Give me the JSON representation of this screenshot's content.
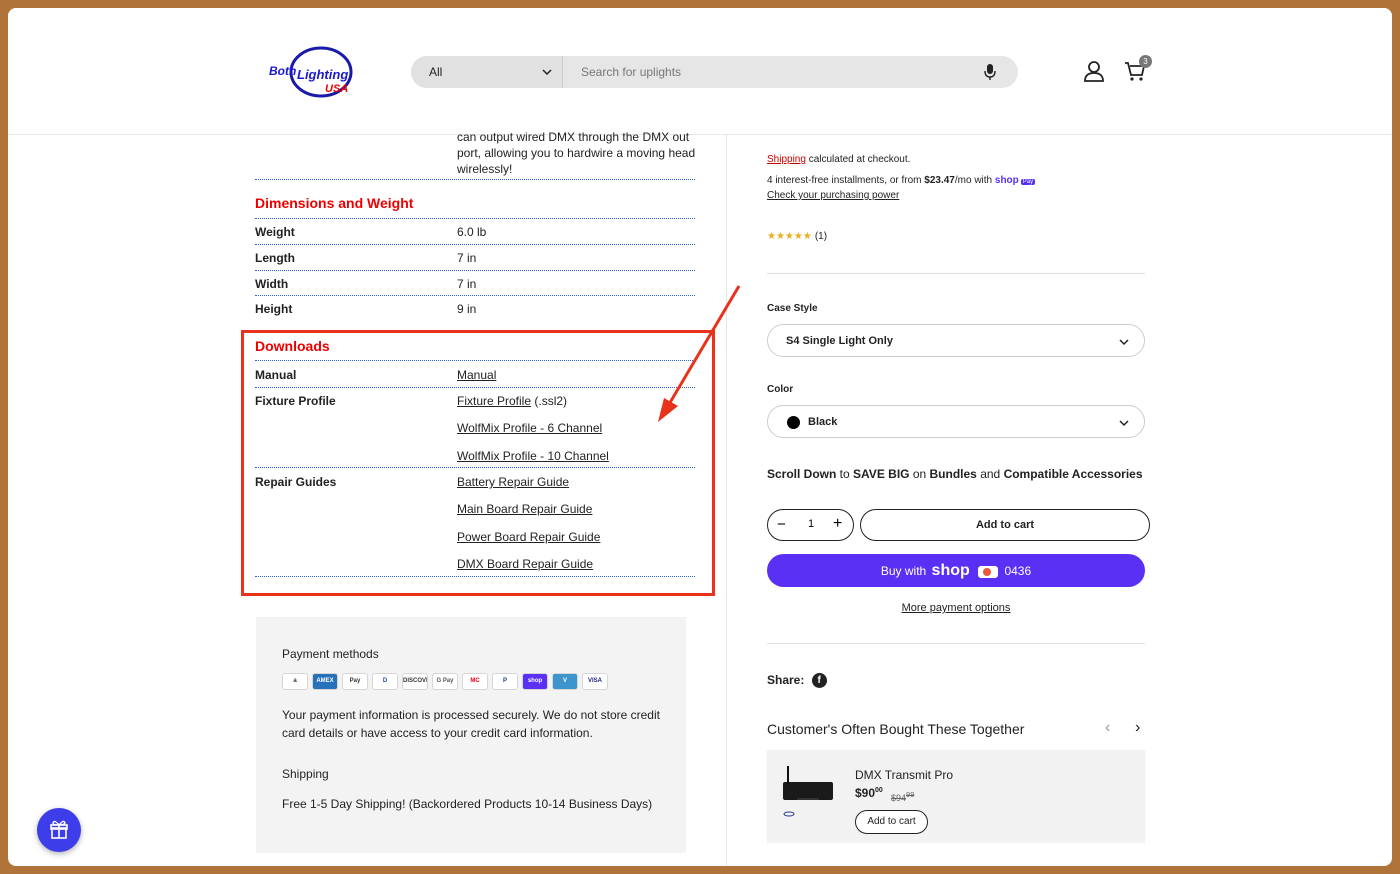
{
  "header": {
    "logo_text": "BothLighting USA",
    "category": "All",
    "search_placeholder": "Search for uplights",
    "cart_count": "3"
  },
  "left": {
    "cut_text": "can output wired DMX through the DMX out port, allowing you to hardwire a moving head wirelessly!",
    "dimensions_title": "Dimensions and Weight",
    "dimensions": [
      {
        "label": "Weight",
        "value": "6.0 lb"
      },
      {
        "label": "Length",
        "value": "7 in"
      },
      {
        "label": "Width",
        "value": "7 in"
      },
      {
        "label": "Height",
        "value": "9 in"
      }
    ],
    "downloads_title": "Downloads",
    "manual_label": "Manual",
    "manual_link": "Manual",
    "fixture_label": "Fixture Profile",
    "fixture_link": "Fixture Profile",
    "fixture_suffix": " (.ssl2)",
    "wolfmix6": "WolfMix Profile - 6 Channel",
    "wolfmix10": "WolfMix Profile - 10 Channel",
    "repair_label": "Repair Guides",
    "repair_links": [
      "Battery Repair Guide",
      "Main Board Repair Guide",
      "Power Board Repair Guide",
      "DMX Board Repair Guide"
    ],
    "payment_title": "Payment methods",
    "payment_icons": [
      "a",
      "AMEX",
      "Pay",
      "D",
      "DISCOVER",
      "G Pay",
      "MC",
      "P",
      "shop",
      "V",
      "VISA"
    ],
    "payment_text": "Your payment information is processed securely. We do not store credit card details or have access to your credit card information.",
    "shipping_title": "Shipping",
    "shipping_text": "Free 1-5 Day Shipping! (Backordered Products 10-14 Business Days)"
  },
  "right": {
    "shipping_link": "Shipping",
    "shipping_rest": " calculated at checkout.",
    "installments_pre": "4 interest-free installments, or from ",
    "installments_amount": "$23.47",
    "installments_post": "/mo with ",
    "shop_pay": "shop",
    "check_power": "Check your purchasing power",
    "review_count": "(1)",
    "case_label": "Case Style",
    "case_value": "S4 Single Light Only",
    "color_label": "Color",
    "color_value": "Black",
    "promo_a": "Scroll Down",
    "promo_b": " to ",
    "promo_c": "SAVE BIG",
    "promo_d": " on ",
    "promo_e": "Bundles",
    "promo_f": " and ",
    "promo_g": "Compatible Accessories",
    "qty": "1",
    "add_to_cart": "Add to cart",
    "buy_with": "Buy with",
    "shop_word": "shop",
    "card_last4": "0436",
    "more_options": "More payment options",
    "share": "Share:",
    "cobt_title": "Customer's Often Bought These Together",
    "product": {
      "name": "DMX Transmit Pro",
      "price": "$90",
      "price_cents": "00",
      "old_price": "$94",
      "old_cents": "99",
      "add": "Add to cart"
    }
  },
  "colors": {
    "accent_red": "#e00000",
    "annotation_red": "#e8321c",
    "shop_purple": "#5a31f4",
    "link_blue_dots": "#2a64c8"
  }
}
